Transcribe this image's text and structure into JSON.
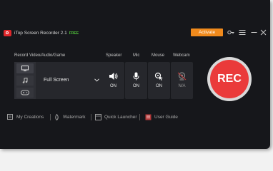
{
  "app": {
    "title": "iTop Screen Recorder 2.1",
    "badge": "FREE"
  },
  "header": {
    "activate_label": "Activate"
  },
  "sections": {
    "record": "Record Video/Audio/Game",
    "speaker": "Speaker",
    "mic": "Mic",
    "mouse": "Mouse",
    "webcam": "Webcam"
  },
  "record_mode": {
    "selected": "Full Screen"
  },
  "devices": {
    "speaker": {
      "status": "ON",
      "icon": "speaker-icon"
    },
    "mic": {
      "status": "ON",
      "icon": "microphone-icon"
    },
    "mouse": {
      "status": "ON",
      "icon": "mouse-icon"
    },
    "webcam": {
      "status": "N/A",
      "icon": "webcam-icon"
    }
  },
  "rec_button": {
    "label": "REC",
    "color": "#ea3a3a"
  },
  "footer": {
    "creations": "My Creations",
    "watermark": "Watermark",
    "quick_launcher": "Quick Launcher",
    "user_guide": "User Guide"
  },
  "colors": {
    "accent": "#f08a1c",
    "record": "#ea3a3a",
    "background": "#16171b"
  }
}
